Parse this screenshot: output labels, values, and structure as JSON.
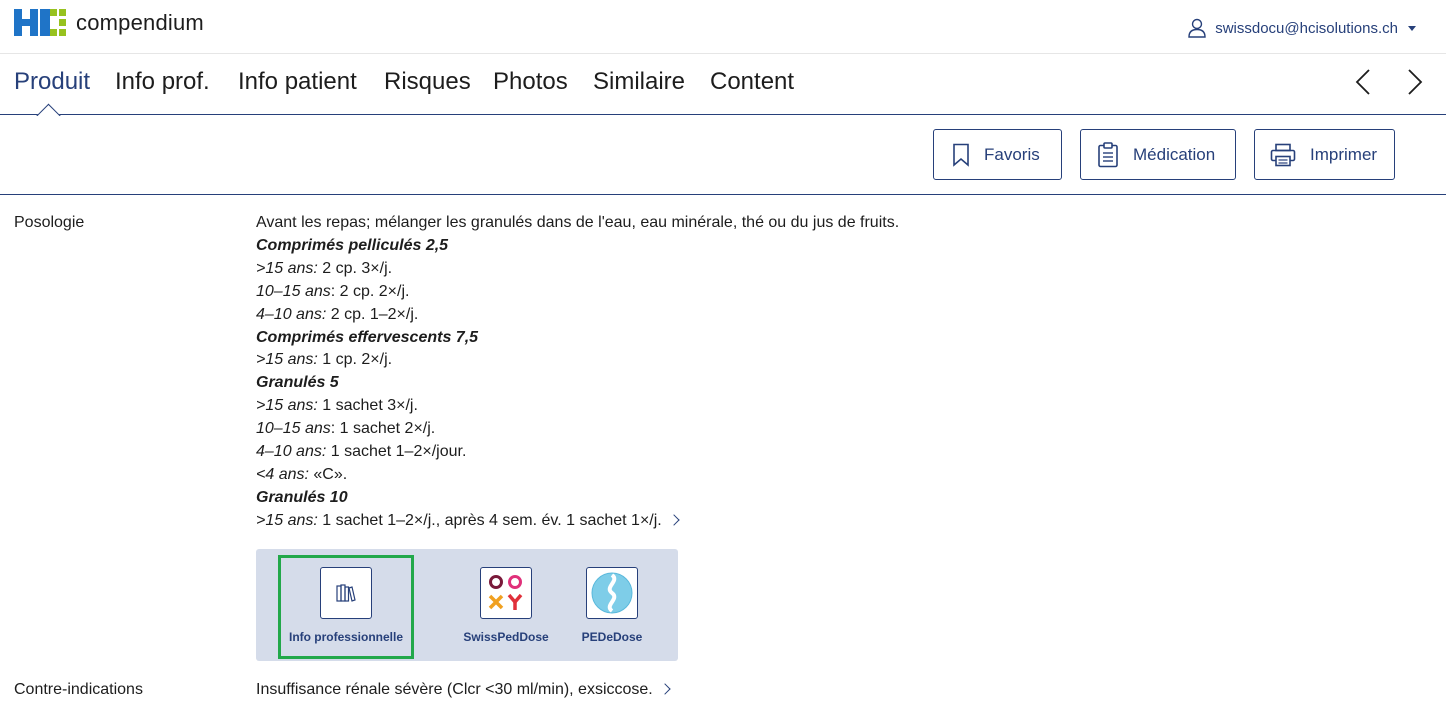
{
  "header": {
    "brand": "compendium",
    "user_email": "swissdocu@hcisolutions.ch"
  },
  "tabs": [
    {
      "label": "Produit",
      "active": true
    },
    {
      "label": "Info prof.",
      "active": false
    },
    {
      "label": "Info patient",
      "active": false
    },
    {
      "label": "Risques",
      "active": false
    },
    {
      "label": "Photos",
      "active": false
    },
    {
      "label": "Similaire",
      "active": false
    },
    {
      "label": "Content",
      "active": false
    }
  ],
  "actions": {
    "favorites": "Favoris",
    "medication": "Médication",
    "print": "Imprimer"
  },
  "posologie": {
    "label": "Posologie",
    "intro": "Avant les repas; mélanger les granulés dans de l'eau, eau minérale, thé ou du jus de fruits.",
    "groups": [
      {
        "heading": "Comprimés pelliculés 2,5",
        "lines": [
          {
            "age": ">15 ans:",
            "dose": " 2 cp. 3×/j."
          },
          {
            "age": "10–15 ans",
            "dose": ": 2 cp. 2×/j."
          },
          {
            "age": "4–10 ans:",
            "dose": " 2 cp. 1–2×/j."
          }
        ]
      },
      {
        "heading": "Comprimés effervescents 7,5",
        "lines": [
          {
            "age": ">15 ans:",
            "dose": " 1 cp. 2×/j."
          }
        ]
      },
      {
        "heading": "Granulés 5",
        "lines": [
          {
            "age": ">15 ans:",
            "dose": " 1 sachet 3×/j."
          },
          {
            "age": "10–15 ans",
            "dose": ": 1 sachet 2×/j."
          },
          {
            "age": "4–10 ans:",
            "dose": " 1 sachet 1–2×/jour."
          },
          {
            "age": "<4 ans:",
            "dose": " «C»."
          }
        ]
      },
      {
        "heading": "Granulés 10",
        "lines": [
          {
            "age": ">15 ans:",
            "dose": " 1 sachet 1–2×/j., après 4 sem. év. 1 sachet 1×/j."
          }
        ]
      }
    ]
  },
  "tools": [
    {
      "label": "Info professionnelle",
      "icon": "books-icon",
      "selected": true
    },
    {
      "label": "SwissPedDose",
      "icon": "swisspeddose-logo",
      "selected": false
    },
    {
      "label": "PEDeDose",
      "icon": "pededose-logo",
      "selected": false
    }
  ],
  "contre_indications": {
    "label": "Contre-indications",
    "text": "Insuffisance rénale sévère (Clcr <30 ml/min), exsiccose."
  },
  "colors": {
    "brand_blue": "#27407a",
    "logo_blue": "#1f74c7",
    "logo_green": "#97c21f",
    "highlight_green": "#22a84a",
    "tool_panel_bg": "#d5dcea"
  }
}
